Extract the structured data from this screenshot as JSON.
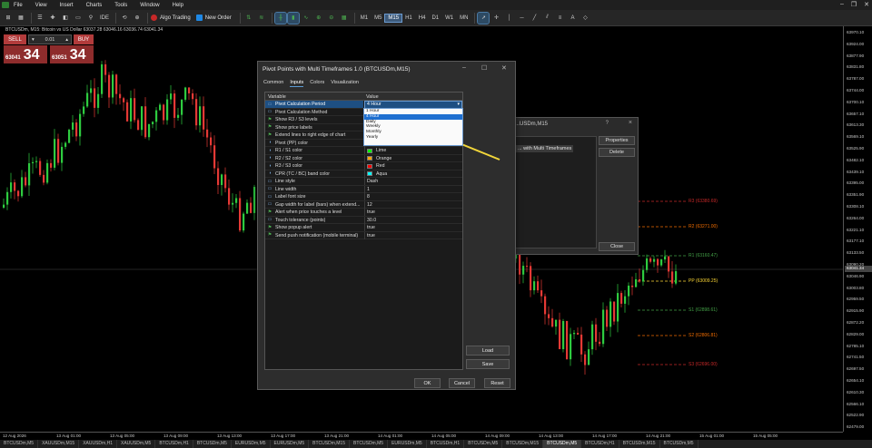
{
  "menu": [
    "File",
    "View",
    "Insert",
    "Charts",
    "Tools",
    "Window",
    "Help"
  ],
  "toolbar": {
    "ide": "IDE",
    "algo_trading": "Algo Trading",
    "new_order": "New Order",
    "timeframes": [
      "M1",
      "M5",
      "M15",
      "H1",
      "H4",
      "D1",
      "W1",
      "MN"
    ],
    "active_timeframe": "M15"
  },
  "chart": {
    "title": "BTCUSDm, M15:  Bitcoin vs US Dollar  63037.28 63046.16 63036.74 63041.34",
    "price_labels": [
      "63970.10",
      "63924.00",
      "63877.90",
      "63831.80",
      "63787.00",
      "63744.00",
      "63700.10",
      "63657.10",
      "63613.30",
      "63569.10",
      "63525.90",
      "63482.10",
      "63439.10",
      "63395.00",
      "63351.90",
      "63308.10",
      "63264.00",
      "63221.10",
      "63177.10",
      "63133.50",
      "63090.20",
      "63046.90",
      "63003.80",
      "62959.50",
      "62915.90",
      "62872.20",
      "62829.00",
      "62785.10",
      "62741.50",
      "62697.50",
      "62654.10",
      "62610.30",
      "62566.10",
      "62522.90",
      "62479.00"
    ],
    "current_price": "63041.34",
    "time_labels": [
      "12 Aug 2026",
      "13 Aug 01:00",
      "13 Aug 05:00",
      "13 Aug 09:00",
      "13 Aug 13:00",
      "13 Aug 17:00",
      "13 Aug 21:00",
      "14 Aug 01:00",
      "14 Aug 05:00",
      "14 Aug 09:00",
      "14 Aug 13:00",
      "14 Aug 17:00",
      "14 Aug 21:00",
      "15 Aug 01:00",
      "15 Aug 05:00"
    ],
    "pivots": [
      {
        "label": "R3 (63380.69)",
        "color": "#c62828"
      },
      {
        "label": "R2 (63271.00)",
        "color": "#ef6c00"
      },
      {
        "label": "R1 (63160.47)",
        "color": "#43a047"
      },
      {
        "label": "PP (63009.25)",
        "color": "#fdd835"
      },
      {
        "label": "S1 (62898.61)",
        "color": "#43a047"
      },
      {
        "label": "S2 (62806.81)",
        "color": "#ef6c00"
      },
      {
        "label": "S3 (62696.00)",
        "color": "#c62828"
      }
    ]
  },
  "one_click": {
    "sell": "SELL",
    "buy": "BUY",
    "volume": "0.01",
    "sell_small": "63041",
    "sell_big": "34",
    "buy_small": "63051",
    "buy_big": "34"
  },
  "bg_dialog": {
    "title": "...USDm,M15",
    "item": "... with Multi Timeframes",
    "properties": "Properties",
    "delete": "Delete",
    "close": "Close",
    "help": "?",
    "close_x": "×"
  },
  "dialog": {
    "title": "Pivot Points with Multi Timeframes 1.0 (BTCUSDm,M15)",
    "tabs": [
      "Common",
      "Inputs",
      "Colors",
      "Visualization"
    ],
    "active_tab": "Inputs",
    "col_variable": "Variable",
    "col_value": "Value",
    "rows": [
      {
        "icon": "num",
        "name": "Pivot Calculation Period",
        "value": "4 Hour",
        "combo": true
      },
      {
        "icon": "num",
        "name": "Pivot Calculation Method",
        "value": ""
      },
      {
        "icon": "flag",
        "name": "Show R3 / S3 levels",
        "value": ""
      },
      {
        "icon": "flag",
        "name": "Show price labels",
        "value": ""
      },
      {
        "icon": "flag",
        "name": "Extend lines to right edge of chart",
        "value": ""
      },
      {
        "icon": "color",
        "name": "Pivot (PP) color",
        "value": "Yellow",
        "swatch": "#ffff00"
      },
      {
        "icon": "color",
        "name": "R1 / S1 color",
        "value": "Lime",
        "swatch": "#00ff00"
      },
      {
        "icon": "color",
        "name": "R2 / S2 color",
        "value": "Orange",
        "swatch": "#ffa500"
      },
      {
        "icon": "color",
        "name": "R3 / S3 color",
        "value": "Red",
        "swatch": "#ff0000"
      },
      {
        "icon": "color",
        "name": "CPR (TC / BC) band color",
        "value": "Aqua",
        "swatch": "#00ffff"
      },
      {
        "icon": "num",
        "name": "Line style",
        "value": "Dash"
      },
      {
        "icon": "num",
        "name": "Line width",
        "value": "1"
      },
      {
        "icon": "num",
        "name": "Label font size",
        "value": "8"
      },
      {
        "icon": "num",
        "name": "Gap width for label (bars) when extend...",
        "value": "12"
      },
      {
        "icon": "flag",
        "name": "Alert when price touches a level",
        "value": "true"
      },
      {
        "icon": "num",
        "name": "Touch tolerance (points)",
        "value": "30.0"
      },
      {
        "icon": "flag",
        "name": "Show popup alert",
        "value": "true"
      },
      {
        "icon": "flag",
        "name": "Send push notification (mobile terminal)",
        "value": "true"
      }
    ],
    "dropdown": [
      "1 Hour",
      "4 Hour",
      "Daily",
      "Weekly",
      "Monthly",
      "Yearly"
    ],
    "dropdown_selected": "4 Hour",
    "load": "Load",
    "save": "Save",
    "ok": "OK",
    "cancel": "Cancel",
    "reset": "Reset"
  },
  "symbol_tabs": [
    "BTCUSDm,M5",
    "XAUUSDm,M15",
    "XAUUSDm,H1",
    "XAUUSDm,M5",
    "BTCUSDm,H1",
    "BTCUSDm,M5",
    "EURUSDm,M5",
    "EURUSDm,M5",
    "BTCUSDm,M15",
    "BTCUSDm,M5",
    "EURUSDm,M5",
    "BTCUSDm,H1",
    "BTCUSDm,M5",
    "BTCUSDm,M15",
    "BTCUSDm,M5",
    "BTCUSDm,H1",
    "BTCUSDm,M15",
    "BTCUSDm,M5"
  ],
  "active_symbol_tab": 14
}
